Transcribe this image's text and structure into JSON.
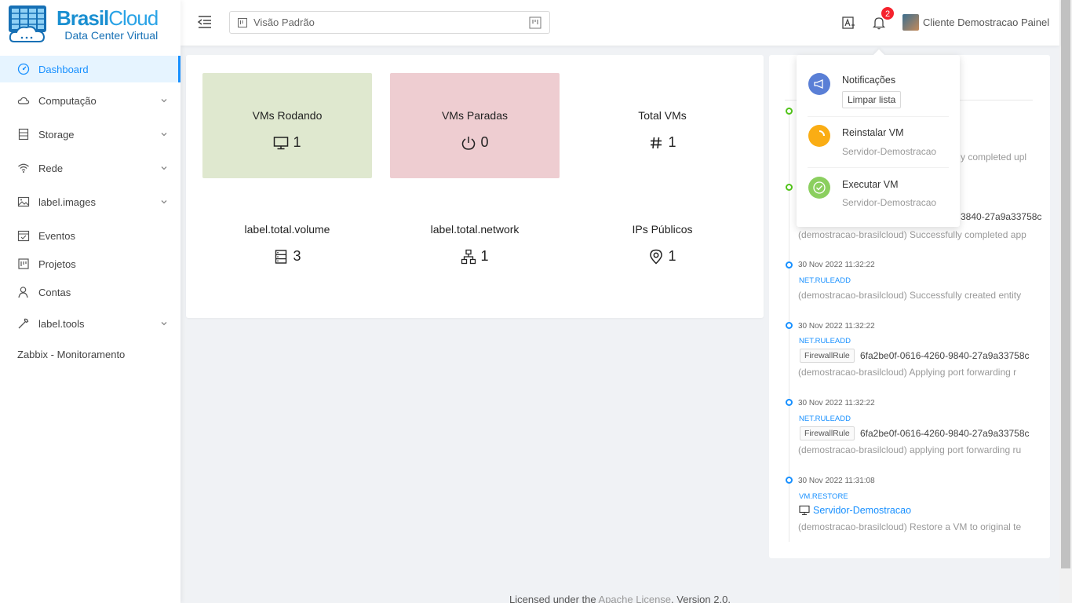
{
  "brand": {
    "name_bold": "Brasil",
    "name_light": "Cloud",
    "subtitle": "Data Center Virtual"
  },
  "sidebar": {
    "items": [
      {
        "label": "Dashboard",
        "icon": "dashboard-icon",
        "active": true
      },
      {
        "label": "Computação",
        "icon": "cloud-icon",
        "has_submenu": true
      },
      {
        "label": "Storage",
        "icon": "storage-icon",
        "has_submenu": true
      },
      {
        "label": "Rede",
        "icon": "wifi-icon",
        "has_submenu": true
      },
      {
        "label": "label.images",
        "icon": "image-icon",
        "has_submenu": true
      },
      {
        "label": "Eventos",
        "icon": "calendar-icon"
      },
      {
        "label": "Projetos",
        "icon": "project-icon"
      },
      {
        "label": "Contas",
        "icon": "user-icon"
      },
      {
        "label": "label.tools",
        "icon": "tool-icon",
        "has_submenu": true
      },
      {
        "label": "Zabbix - Monitoramento"
      }
    ]
  },
  "header": {
    "view_label": "Visão Padrão",
    "notification_count": "2",
    "user_name": "Cliente Demostracao Painel"
  },
  "stats": [
    {
      "label": "VMs Rodando",
      "value": "1",
      "icon": "desktop-icon",
      "bg": "#dfe8cf"
    },
    {
      "label": "VMs Paradas",
      "value": "0",
      "icon": "power-icon",
      "bg": "#eecdd1"
    },
    {
      "label": "Total VMs",
      "value": "1",
      "icon": "hash-icon",
      "bg": "#ffffff"
    },
    {
      "label": "label.total.volume",
      "value": "3",
      "icon": "database-icon",
      "bg": "#ffffff"
    },
    {
      "label": "label.total.network",
      "value": "1",
      "icon": "cluster-icon",
      "bg": "#ffffff"
    },
    {
      "label": "IPs Públicos",
      "value": "1",
      "icon": "location-icon",
      "bg": "#ffffff"
    }
  ],
  "events": {
    "partial": [
      {
        "desc": "y completed upl"
      },
      {
        "id": "3840-27a9a33758c",
        "desc": "(demostracao-brasilcloud) Successfully completed app"
      }
    ],
    "items": [
      {
        "date": "30 Nov 2022 11:32:22",
        "type": "NET.RULEADD",
        "desc": "(demostracao-brasilcloud) Successfully created entity"
      },
      {
        "date": "30 Nov 2022 11:32:22",
        "type": "NET.RULEADD",
        "tag": "FirewallRule",
        "id": "6fa2be0f-0616-4260-9840-27a9a33758c",
        "desc": "(demostracao-brasilcloud) Applying port forwarding r"
      },
      {
        "date": "30 Nov 2022 11:32:22",
        "type": "NET.RULEADD",
        "tag": "FirewallRule",
        "id": "6fa2be0f-0616-4260-9840-27a9a33758c",
        "desc": "(demostracao-brasilcloud) applying port forwarding ru"
      },
      {
        "date": "30 Nov 2022 11:31:08",
        "type": "VM.RESTORE",
        "link": "Servidor-Demostracao",
        "desc": "(demostracao-brasilcloud) Restore a VM to original te"
      }
    ]
  },
  "notifications": {
    "title": "Notificações",
    "clear_label": "Limpar lista",
    "items": [
      {
        "title": "Reinstalar VM",
        "sub": "Servidor-Demostracao",
        "color": "#faad14"
      },
      {
        "title": "Executar VM",
        "sub": "Servidor-Demostracao",
        "color": "#8bcf5f"
      }
    ]
  },
  "footer": {
    "prefix": "Licensed under the ",
    "link": "Apache License",
    "suffix": ", Version 2.0."
  }
}
